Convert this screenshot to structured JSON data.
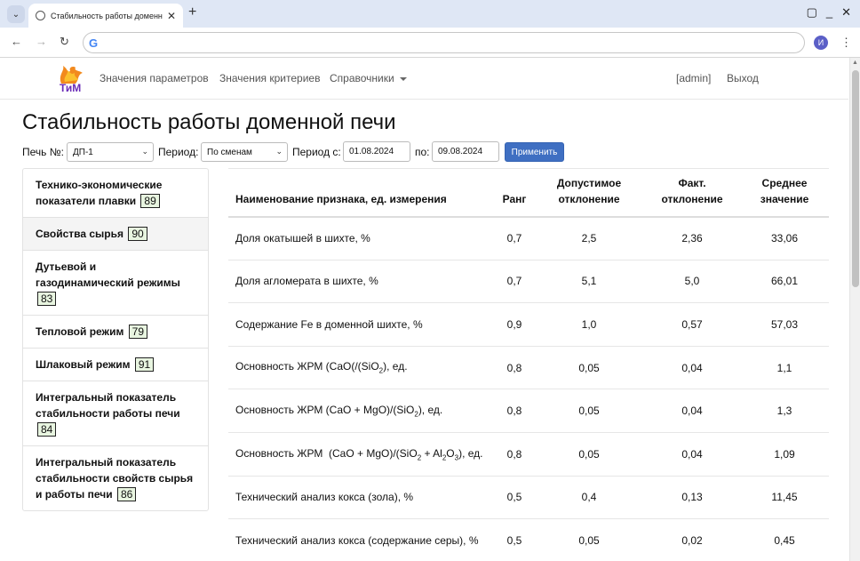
{
  "browser": {
    "tab_title": "Стабильность работы доменн",
    "profile_initial": "И"
  },
  "navbar": {
    "menu": [
      "Значения параметров",
      "Значения критериев",
      "Справочники"
    ],
    "user": "[admin]",
    "logout": "Выход"
  },
  "page": {
    "title": "Стабильность работы доменной печи"
  },
  "filters": {
    "furnace_label": "Печь №:",
    "furnace_value": "ДП-1",
    "period_label": "Период:",
    "period_value": "По сменам",
    "from_label": "Период с:",
    "from_value": "01.08.2024",
    "to_label": "по:",
    "to_value": "09.08.2024",
    "apply": "Применить"
  },
  "sidebar": {
    "items": [
      {
        "label": "Технико-экономические показатели плавки",
        "badge": "89",
        "active": false
      },
      {
        "label": "Свойства сырья",
        "badge": "90",
        "active": true
      },
      {
        "label": "Дутьевой и газодинамический режимы",
        "badge": "83",
        "active": false
      },
      {
        "label": "Тепловой режим",
        "badge": "79",
        "active": false
      },
      {
        "label": "Шлаковый режим",
        "badge": "91",
        "active": false
      },
      {
        "label": "Интегральный показатель стабильности работы печи",
        "badge": "84",
        "active": false
      },
      {
        "label": "Интегральный показатель стабильности свойств сырья и работы печи",
        "badge": "86",
        "active": false
      }
    ]
  },
  "table": {
    "headers": {
      "name": "Наименование признака, ед. измерения",
      "rank": "Ранг",
      "allowed_1": "Допустимое",
      "allowed_2": "отклонение",
      "actual_1": "Факт.",
      "actual_2": "отклонение",
      "mean_1": "Среднее",
      "mean_2": "значение"
    },
    "rows": [
      {
        "name": "Доля окатышей в шихте, %",
        "rank": "0,7",
        "allowed": "2,5",
        "actual": "2,36",
        "mean": "33,06"
      },
      {
        "name": "Доля агломерата в шихте, %",
        "rank": "0,7",
        "allowed": "5,1",
        "actual": "5,0",
        "mean": "66,01"
      },
      {
        "name": "Содержание Fe в доменной шихте, %",
        "rank": "0,9",
        "allowed": "1,0",
        "actual": "0,57",
        "mean": "57,03"
      },
      {
        "name_html": "Основность ЖРМ (CaO(/(SiO<sub>2</sub>), ед.",
        "rank": "0,8",
        "allowed": "0,05",
        "actual": "0,04",
        "mean": "1,1"
      },
      {
        "name_html": "Основность ЖРМ (CaO + MgO)/(SiO<sub>2</sub>), ед.",
        "rank": "0,8",
        "allowed": "0,05",
        "actual": "0,04",
        "mean": "1,3"
      },
      {
        "name_html": "Основность ЖРМ &nbsp;(CaO + MgO)/(SiO<sub>2</sub> + Al<sub>2</sub>O<sub>3</sub>), ед.",
        "rank": "0,8",
        "allowed": "0,05",
        "actual": "0,04",
        "mean": "1,09"
      },
      {
        "name": "Технический анализ кокса (зола), %",
        "rank": "0,5",
        "allowed": "0,4",
        "actual": "0,13",
        "mean": "11,45"
      },
      {
        "name": "Технический анализ кокса (содержание серы), %",
        "rank": "0,5",
        "allowed": "0,05",
        "actual": "0,02",
        "mean": "0,45"
      }
    ]
  }
}
